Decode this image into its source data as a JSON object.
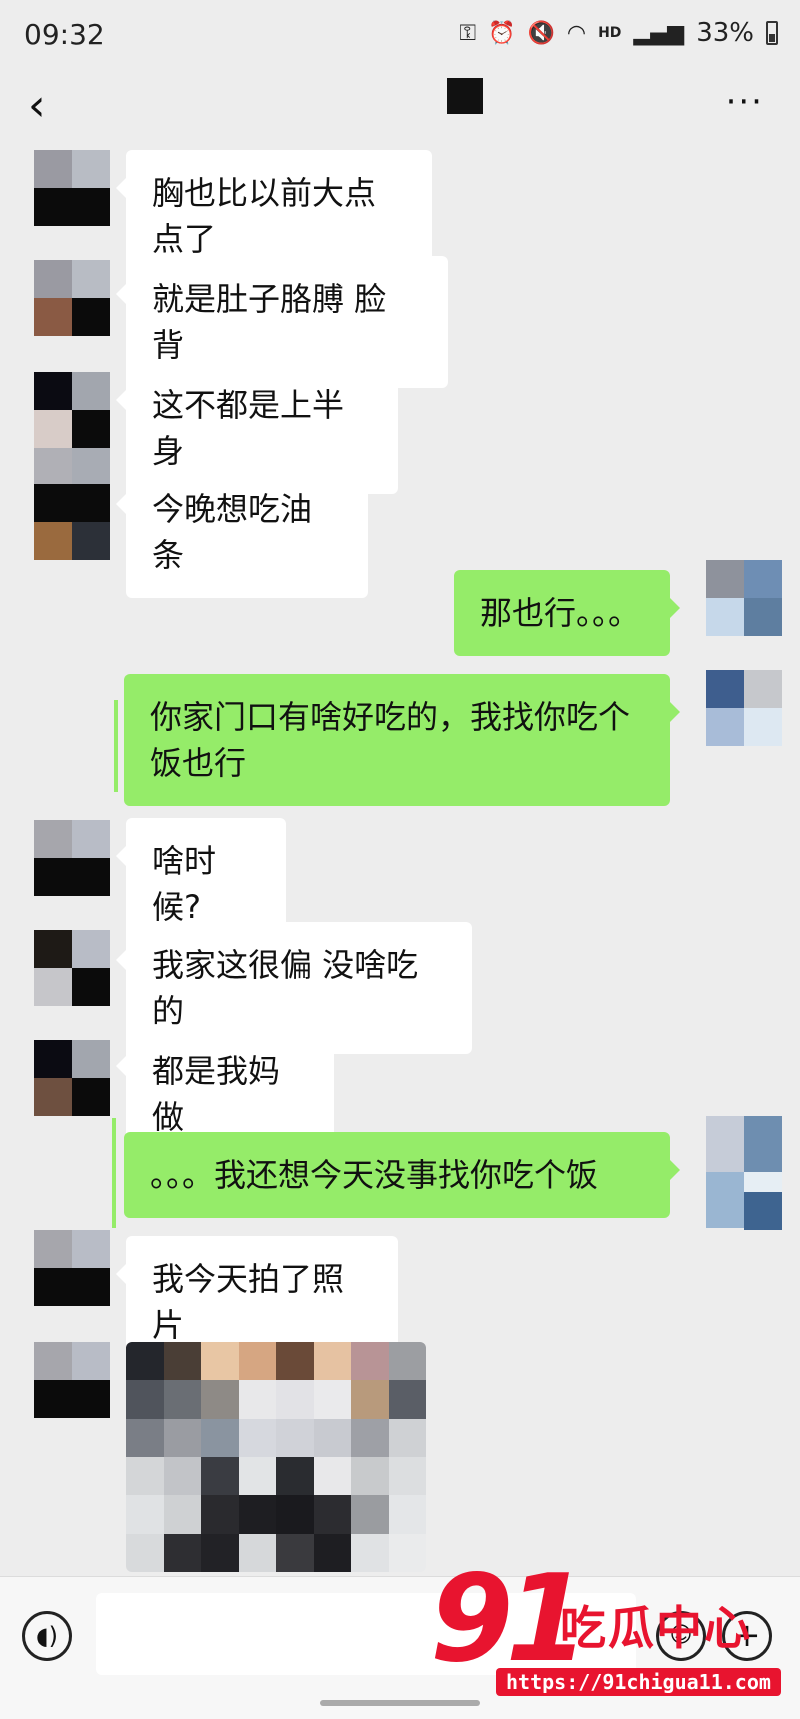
{
  "status_bar": {
    "time": "09:32",
    "battery": "33%",
    "network": "HD"
  },
  "header": {
    "more": "···",
    "back": "‹"
  },
  "messages": [
    {
      "side": "in",
      "text": "胸也比以前大点点了"
    },
    {
      "side": "in",
      "text": "就是肚子胳膊 脸 背"
    },
    {
      "side": "in",
      "text": "这不都是上半身"
    },
    {
      "side": "in",
      "text": "今晚想吃油条"
    },
    {
      "side": "out",
      "text": "那也行。。。"
    },
    {
      "side": "out",
      "text": "你家门口有啥好吃的，我找你吃个饭也行"
    },
    {
      "side": "in",
      "text": "啥时候?"
    },
    {
      "side": "in",
      "text": "我家这很偏 没啥吃的"
    },
    {
      "side": "in",
      "text": "都是我妈做"
    },
    {
      "side": "out",
      "text": "。。。我还想今天没事找你吃个饭"
    },
    {
      "side": "in",
      "text": "我今天拍了照片"
    },
    {
      "side": "in",
      "type": "image"
    }
  ],
  "input_bar": {
    "voice_icon": "voice-icon",
    "emoji_icon": "emoji-icon",
    "plus_icon": "plus-icon"
  },
  "watermark": {
    "number": "91",
    "text": "吃瓜中心",
    "url": "https://91chigua11.com"
  },
  "colors": {
    "outgoing_bubble": "#95ec69",
    "incoming_bubble": "#ffffff",
    "background": "#ededed",
    "watermark": "#e8142f"
  }
}
